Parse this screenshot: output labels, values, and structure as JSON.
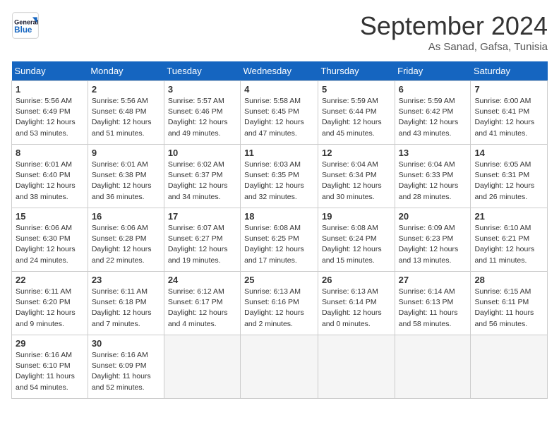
{
  "header": {
    "logo_text_general": "General",
    "logo_text_blue": "Blue",
    "month_year": "September 2024",
    "location": "As Sanad, Gafsa, Tunisia"
  },
  "weekdays": [
    "Sunday",
    "Monday",
    "Tuesday",
    "Wednesday",
    "Thursday",
    "Friday",
    "Saturday"
  ],
  "weeks": [
    [
      {
        "day": "1",
        "rise": "Sunrise: 5:56 AM",
        "set": "Sunset: 6:49 PM",
        "light": "Daylight: 12 hours and 53 minutes."
      },
      {
        "day": "2",
        "rise": "Sunrise: 5:56 AM",
        "set": "Sunset: 6:48 PM",
        "light": "Daylight: 12 hours and 51 minutes."
      },
      {
        "day": "3",
        "rise": "Sunrise: 5:57 AM",
        "set": "Sunset: 6:46 PM",
        "light": "Daylight: 12 hours and 49 minutes."
      },
      {
        "day": "4",
        "rise": "Sunrise: 5:58 AM",
        "set": "Sunset: 6:45 PM",
        "light": "Daylight: 12 hours and 47 minutes."
      },
      {
        "day": "5",
        "rise": "Sunrise: 5:59 AM",
        "set": "Sunset: 6:44 PM",
        "light": "Daylight: 12 hours and 45 minutes."
      },
      {
        "day": "6",
        "rise": "Sunrise: 5:59 AM",
        "set": "Sunset: 6:42 PM",
        "light": "Daylight: 12 hours and 43 minutes."
      },
      {
        "day": "7",
        "rise": "Sunrise: 6:00 AM",
        "set": "Sunset: 6:41 PM",
        "light": "Daylight: 12 hours and 41 minutes."
      }
    ],
    [
      {
        "day": "8",
        "rise": "Sunrise: 6:01 AM",
        "set": "Sunset: 6:40 PM",
        "light": "Daylight: 12 hours and 38 minutes."
      },
      {
        "day": "9",
        "rise": "Sunrise: 6:01 AM",
        "set": "Sunset: 6:38 PM",
        "light": "Daylight: 12 hours and 36 minutes."
      },
      {
        "day": "10",
        "rise": "Sunrise: 6:02 AM",
        "set": "Sunset: 6:37 PM",
        "light": "Daylight: 12 hours and 34 minutes."
      },
      {
        "day": "11",
        "rise": "Sunrise: 6:03 AM",
        "set": "Sunset: 6:35 PM",
        "light": "Daylight: 12 hours and 32 minutes."
      },
      {
        "day": "12",
        "rise": "Sunrise: 6:04 AM",
        "set": "Sunset: 6:34 PM",
        "light": "Daylight: 12 hours and 30 minutes."
      },
      {
        "day": "13",
        "rise": "Sunrise: 6:04 AM",
        "set": "Sunset: 6:33 PM",
        "light": "Daylight: 12 hours and 28 minutes."
      },
      {
        "day": "14",
        "rise": "Sunrise: 6:05 AM",
        "set": "Sunset: 6:31 PM",
        "light": "Daylight: 12 hours and 26 minutes."
      }
    ],
    [
      {
        "day": "15",
        "rise": "Sunrise: 6:06 AM",
        "set": "Sunset: 6:30 PM",
        "light": "Daylight: 12 hours and 24 minutes."
      },
      {
        "day": "16",
        "rise": "Sunrise: 6:06 AM",
        "set": "Sunset: 6:28 PM",
        "light": "Daylight: 12 hours and 22 minutes."
      },
      {
        "day": "17",
        "rise": "Sunrise: 6:07 AM",
        "set": "Sunset: 6:27 PM",
        "light": "Daylight: 12 hours and 19 minutes."
      },
      {
        "day": "18",
        "rise": "Sunrise: 6:08 AM",
        "set": "Sunset: 6:25 PM",
        "light": "Daylight: 12 hours and 17 minutes."
      },
      {
        "day": "19",
        "rise": "Sunrise: 6:08 AM",
        "set": "Sunset: 6:24 PM",
        "light": "Daylight: 12 hours and 15 minutes."
      },
      {
        "day": "20",
        "rise": "Sunrise: 6:09 AM",
        "set": "Sunset: 6:23 PM",
        "light": "Daylight: 12 hours and 13 minutes."
      },
      {
        "day": "21",
        "rise": "Sunrise: 6:10 AM",
        "set": "Sunset: 6:21 PM",
        "light": "Daylight: 12 hours and 11 minutes."
      }
    ],
    [
      {
        "day": "22",
        "rise": "Sunrise: 6:11 AM",
        "set": "Sunset: 6:20 PM",
        "light": "Daylight: 12 hours and 9 minutes."
      },
      {
        "day": "23",
        "rise": "Sunrise: 6:11 AM",
        "set": "Sunset: 6:18 PM",
        "light": "Daylight: 12 hours and 7 minutes."
      },
      {
        "day": "24",
        "rise": "Sunrise: 6:12 AM",
        "set": "Sunset: 6:17 PM",
        "light": "Daylight: 12 hours and 4 minutes."
      },
      {
        "day": "25",
        "rise": "Sunrise: 6:13 AM",
        "set": "Sunset: 6:16 PM",
        "light": "Daylight: 12 hours and 2 minutes."
      },
      {
        "day": "26",
        "rise": "Sunrise: 6:13 AM",
        "set": "Sunset: 6:14 PM",
        "light": "Daylight: 12 hours and 0 minutes."
      },
      {
        "day": "27",
        "rise": "Sunrise: 6:14 AM",
        "set": "Sunset: 6:13 PM",
        "light": "Daylight: 11 hours and 58 minutes."
      },
      {
        "day": "28",
        "rise": "Sunrise: 6:15 AM",
        "set": "Sunset: 6:11 PM",
        "light": "Daylight: 11 hours and 56 minutes."
      }
    ],
    [
      {
        "day": "29",
        "rise": "Sunrise: 6:16 AM",
        "set": "Sunset: 6:10 PM",
        "light": "Daylight: 11 hours and 54 minutes."
      },
      {
        "day": "30",
        "rise": "Sunrise: 6:16 AM",
        "set": "Sunset: 6:09 PM",
        "light": "Daylight: 11 hours and 52 minutes."
      },
      null,
      null,
      null,
      null,
      null
    ]
  ]
}
